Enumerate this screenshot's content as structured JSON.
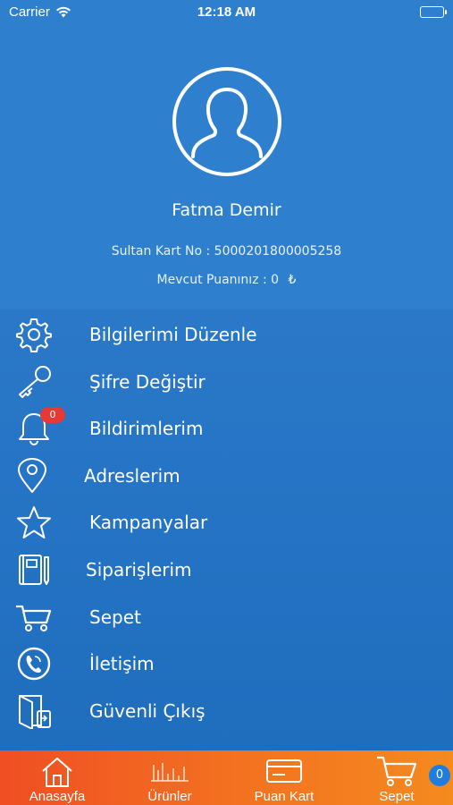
{
  "status_bar": {
    "carrier": "Carrier",
    "time": "12:18 AM"
  },
  "profile": {
    "name": "Fatma Demir",
    "card_label": "Sultan Kart No : 5000201800005258",
    "points_label": "Mevcut Puanınız : 0",
    "points_currency": "₺"
  },
  "menu": {
    "items": [
      {
        "label": "Bilgilerimi Düzenle",
        "icon": "gear-icon"
      },
      {
        "label": "Şifre Değiştir",
        "icon": "key-icon"
      },
      {
        "label": "Bildirimlerim",
        "icon": "bell-icon",
        "badge": "0"
      },
      {
        "label": "Adreslerim",
        "icon": "location-pin-icon"
      },
      {
        "label": "Kampanyalar",
        "icon": "star-icon"
      },
      {
        "label": "Siparişlerim",
        "icon": "notebook-icon"
      },
      {
        "label": "Sepet",
        "icon": "cart-icon"
      },
      {
        "label": "İletişim",
        "icon": "phone-icon"
      },
      {
        "label": "Güvenli Çıkış",
        "icon": "logout-door-icon"
      }
    ]
  },
  "tabbar": {
    "tabs": [
      {
        "label": "Anasayfa",
        "icon": "home-icon"
      },
      {
        "label": "Ürünler",
        "icon": "products-icon"
      },
      {
        "label": "Puan Kart",
        "icon": "card-icon"
      },
      {
        "label": "Sepet",
        "icon": "cart-icon"
      }
    ],
    "cart_count": "0"
  },
  "colors": {
    "header_blue": "#2e80cf",
    "menu_blue": "#2473c4",
    "tabbar_orange": "#f37020",
    "badge_red": "#e53935"
  }
}
